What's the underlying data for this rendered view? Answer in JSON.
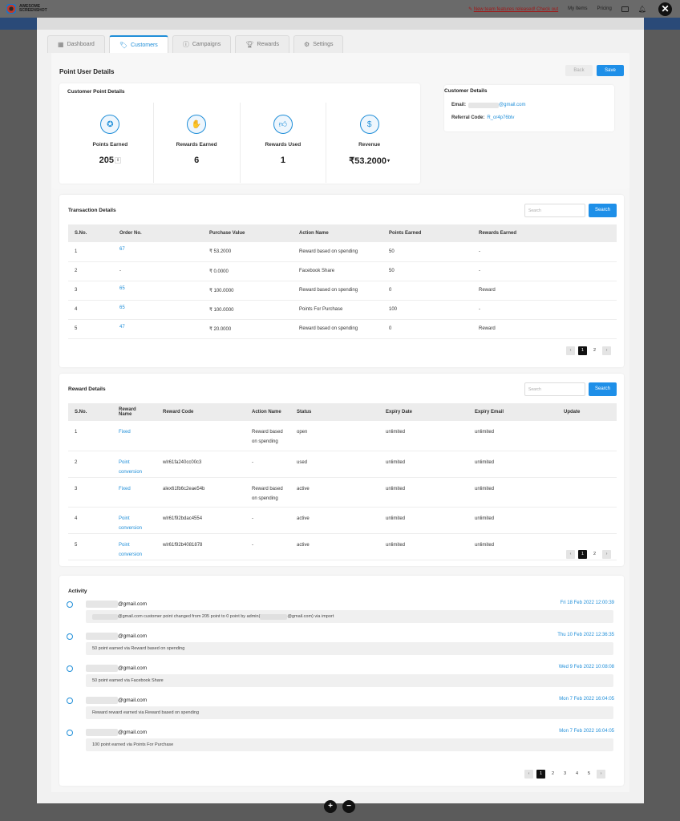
{
  "topbar": {
    "logo_line1": "AWESOME",
    "logo_line2": "SCREENSHOT",
    "announcement": "New team features released! Check out",
    "my_items": "My Items",
    "pricing": "Pricing",
    "close_symbol": "✕"
  },
  "tabs": [
    {
      "label": "Dashboard",
      "icon": "dashboard-icon"
    },
    {
      "label": "Customers",
      "icon": "tag-icon"
    },
    {
      "label": "Campaigns",
      "icon": "info-icon"
    },
    {
      "label": "Rewards",
      "icon": "trophy-icon"
    },
    {
      "label": "Settings",
      "icon": "gear-icon"
    }
  ],
  "header": {
    "title": "Point User Details",
    "back_label": "Back",
    "save_label": "Save"
  },
  "customer_points": {
    "title": "Customer Point Details",
    "stats": [
      {
        "label": "Points Earned",
        "value": "205",
        "icon": "badge-icon"
      },
      {
        "label": "Rewards Earned",
        "value": "6",
        "icon": "hand-coin-icon"
      },
      {
        "label": "Rewards Used",
        "value": "1",
        "icon": "thumbs-up-icon"
      },
      {
        "label": "Revenue",
        "value": "₹53.2000",
        "icon": "dollar-icon"
      }
    ]
  },
  "customer_details": {
    "title": "Customer Details",
    "email_label": "Email:",
    "email_value": "@gmail.com",
    "referral_label": "Referral Code:",
    "referral_value": "R_or4p76blv"
  },
  "transactions": {
    "title": "Transaction Details",
    "search_placeholder": "Search",
    "search_label": "Search",
    "columns": [
      "S.No.",
      "Order No.",
      "Purchase Value",
      "Action Name",
      "Points Earned",
      "Rewards Earned"
    ],
    "rows": [
      [
        "1",
        "67",
        "₹ 53.2000",
        "Reward based on spending",
        "50",
        "-"
      ],
      [
        "2",
        "-",
        "₹ 0.0000",
        "Facebook Share",
        "50",
        "-"
      ],
      [
        "3",
        "65",
        "₹ 100.0000",
        "Reward based on spending",
        "0",
        "Reward"
      ],
      [
        "4",
        "65",
        "₹ 100.0000",
        "Points For Purchase",
        "100",
        "-"
      ],
      [
        "5",
        "47",
        "₹ 20.0000",
        "Reward based on spending",
        "0",
        "Reward"
      ]
    ],
    "pages": [
      "1",
      "2"
    ]
  },
  "rewards": {
    "title": "Reward Details",
    "search_placeholder": "Search",
    "search_label": "Search",
    "columns": [
      "S.No.",
      "Reward Name",
      "Reward Code",
      "Action Name",
      "Status",
      "Expiry Date",
      "Expiry Email",
      "Update"
    ],
    "rows": [
      [
        "1",
        "Fixed",
        "",
        "Reward based on spending",
        "open",
        "unlimited",
        "unlimited",
        ""
      ],
      [
        "2",
        "Point conversion",
        "wlr61fa240cc00c3",
        "-",
        "used",
        "unlimited",
        "unlimited",
        ""
      ],
      [
        "3",
        "Fixed",
        "alex61fb6c2eae54b",
        "Reward based on spending",
        "active",
        "unlimited",
        "unlimited",
        ""
      ],
      [
        "4",
        "Point conversion",
        "wlr61f92bdac4554",
        "-",
        "active",
        "unlimited",
        "unlimited",
        ""
      ],
      [
        "5",
        "Point conversion",
        "wlr61f92b4081878",
        "-",
        "active",
        "unlimited",
        "unlimited",
        ""
      ]
    ],
    "pages": [
      "1",
      "2"
    ]
  },
  "activity": {
    "title": "Activity",
    "items": [
      {
        "user": "@gmail.com",
        "time": "Fri 18 Feb 2022 12:00:39",
        "msg_a": "@gmail.com customer point changed from 205 point to 0 point by admin(",
        "msg_b": "@gmail.com) via import"
      },
      {
        "user": "@gmail.com",
        "time": "Thu 10 Feb 2022 12:36:35",
        "msg_a": "50 point earned via Reward based on spending",
        "msg_b": ""
      },
      {
        "user": "@gmail.com",
        "time": "Wed 9 Feb 2022 10:08:08",
        "msg_a": "50 point earned via Facebook Share",
        "msg_b": ""
      },
      {
        "user": "@gmail.com",
        "time": "Mon 7 Feb 2022 16:04:05",
        "msg_a": "Reward reward earned via Reward based on spending",
        "msg_b": ""
      },
      {
        "user": "@gmail.com",
        "time": "Mon 7 Feb 2022 16:04:05",
        "msg_a": "100 point earned via Points For Purchase",
        "msg_b": ""
      }
    ],
    "pages": [
      "1",
      "2",
      "3",
      "4",
      "5"
    ]
  },
  "zoom": {
    "in": "+",
    "out": "−"
  }
}
